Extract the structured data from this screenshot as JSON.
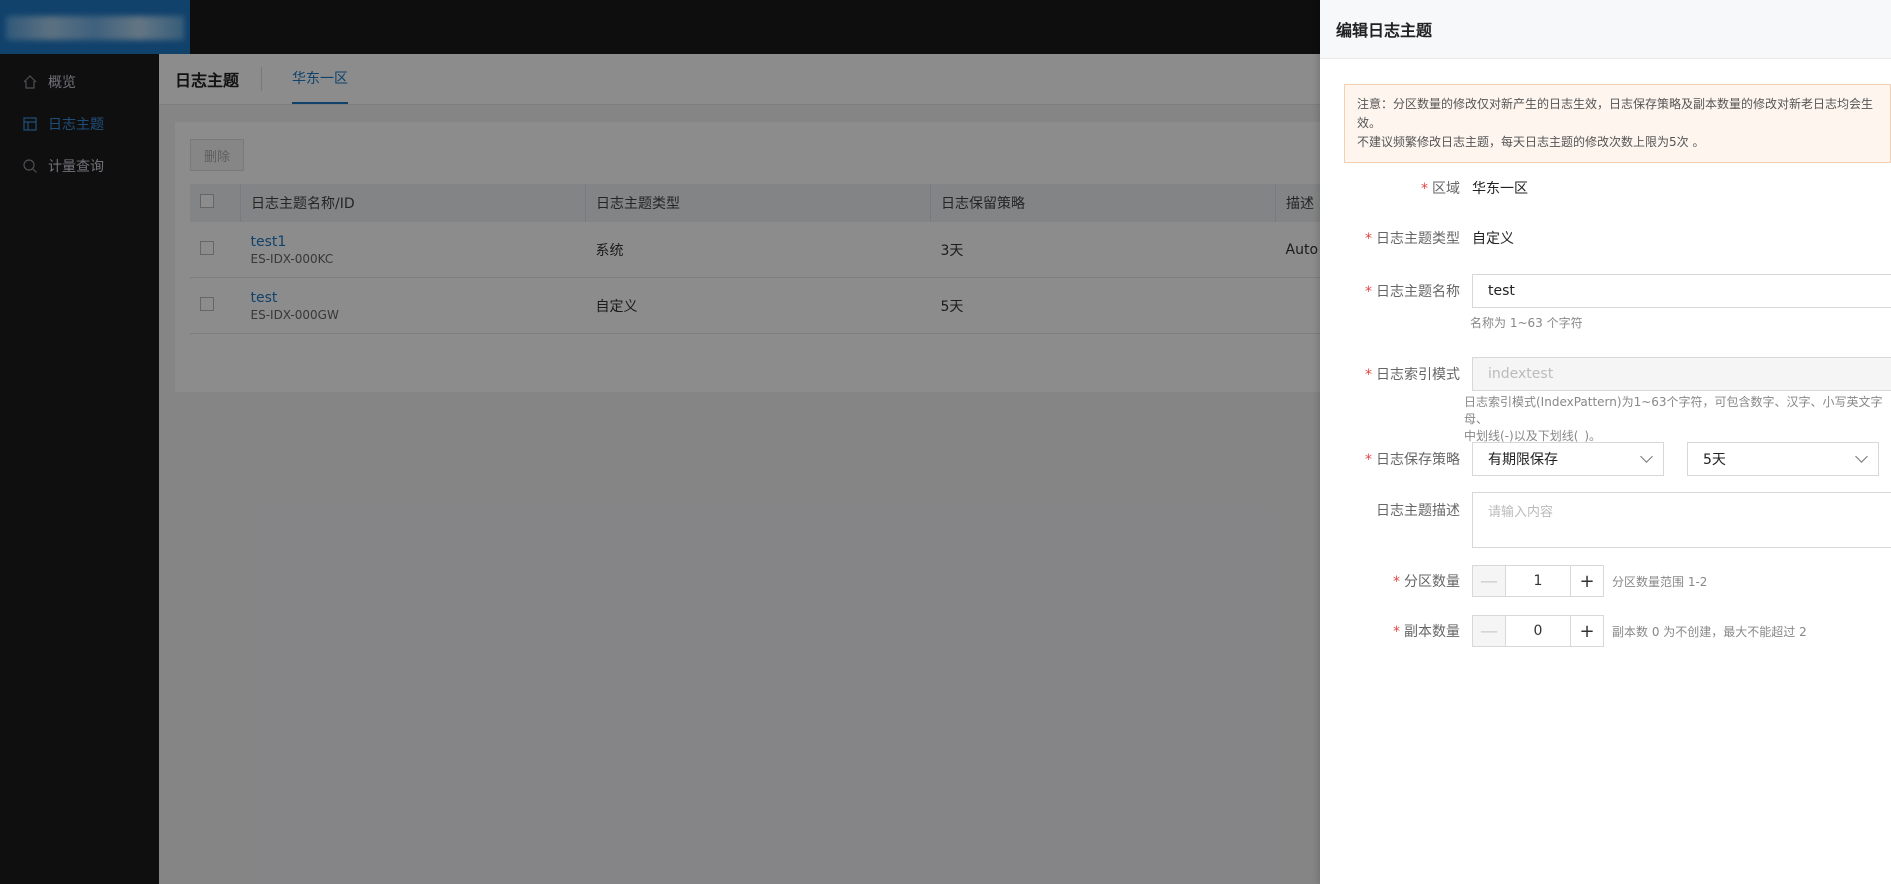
{
  "sidebar": {
    "items": [
      {
        "label": "概览",
        "icon": "home-icon",
        "active": false
      },
      {
        "label": "日志主题",
        "icon": "layout-icon",
        "active": true
      },
      {
        "label": "计量查询",
        "icon": "search-icon",
        "active": false
      }
    ]
  },
  "page": {
    "title": "日志主题",
    "region_tab": "华东一区",
    "delete_label": "删除"
  },
  "table": {
    "headers": [
      "日志主题名称/ID",
      "日志主题类型",
      "日志保留策略",
      "描述"
    ],
    "rows": [
      {
        "name": "test1",
        "id": "ES-IDX-000KC",
        "type": "系统",
        "retention": "3天",
        "desc": "Auto C"
      },
      {
        "name": "test",
        "id": "ES-IDX-000GW",
        "type": "自定义",
        "retention": "5天",
        "desc": ""
      }
    ]
  },
  "drawer": {
    "title": "编辑日志主题",
    "notice_line1": "注意：分区数量的修改仅对新产生的日志生效，日志保存策略及副本数量的修改对新老日志均会生效。",
    "notice_line2": "不建议频繁修改日志主题，每天日志主题的修改次数上限为5次 。",
    "required_mark": "*",
    "region_label": "区域",
    "region_value": "华东一区",
    "type_label": "日志主题类型",
    "type_value": "自定义",
    "name_label": "日志主题名称",
    "name_value": "test",
    "name_hint": "名称为 1~63 个字符",
    "pattern_label": "日志索引模式",
    "pattern_value": "indextest",
    "pattern_hint_1": "日志索引模式(IndexPattern)为1~63个字符，可包含数字、汉字、小写英文字母、",
    "pattern_hint_2": "中划线(-)以及下划线(_)。",
    "retention_label": "日志保存策略",
    "retention_mode": "有期限保存",
    "retention_days": "5天",
    "desc_label": "日志主题描述",
    "desc_placeholder": "请输入内容",
    "partition_label": "分区数量",
    "partition_value": "1",
    "partition_hint": "分区数量范围 1-2",
    "replica_label": "副本数量",
    "replica_value": "0",
    "replica_hint": "副本数 0 为不创建，最大不能超过 2",
    "minus": "—",
    "plus": "+"
  }
}
